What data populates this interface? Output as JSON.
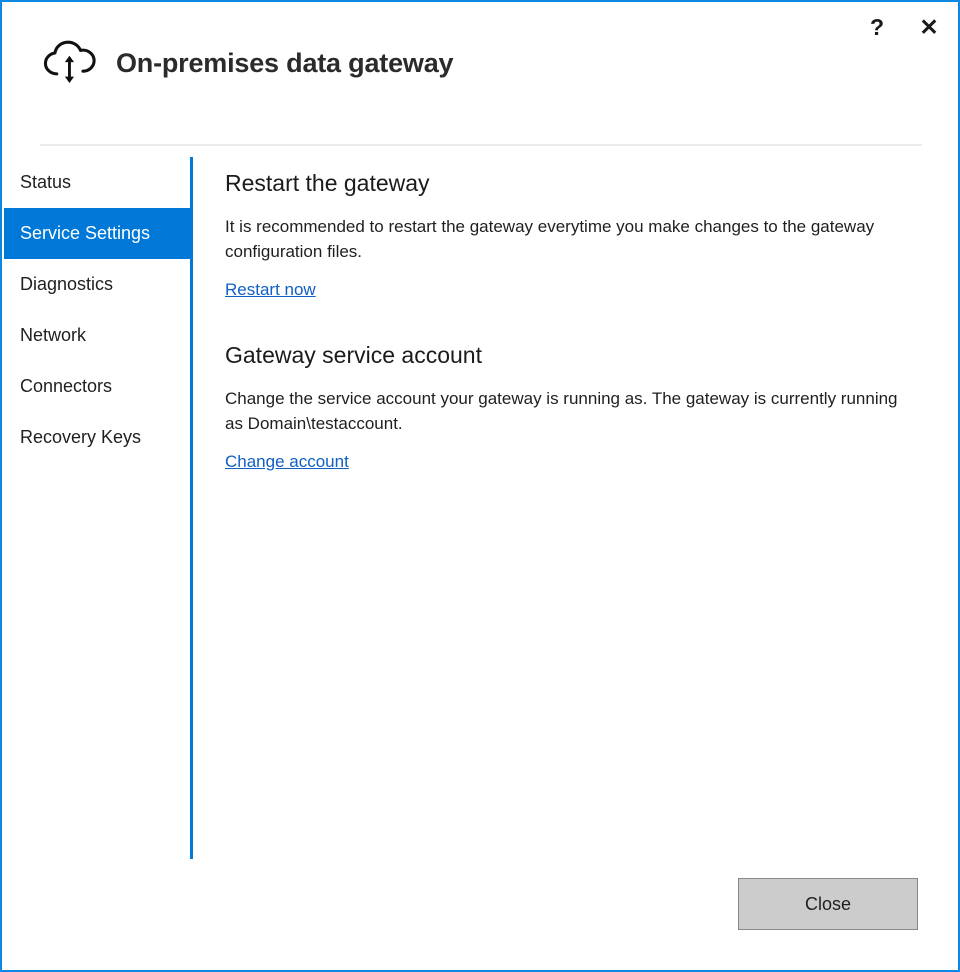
{
  "window": {
    "border_color": "#0d87e0",
    "accent_color": "#0078d7",
    "link_color": "#1060c4"
  },
  "titlebar": {
    "help_label": "?",
    "close_label": "✕",
    "help_icon": "question-mark-icon",
    "close_icon": "close-x-icon"
  },
  "header": {
    "title": "On-premises data gateway",
    "icon": "cloud-with-up-down-arrow-icon"
  },
  "sidebar": {
    "items": [
      {
        "label": "Status",
        "selected": false
      },
      {
        "label": "Service Settings",
        "selected": true
      },
      {
        "label": "Diagnostics",
        "selected": false
      },
      {
        "label": "Network",
        "selected": false
      },
      {
        "label": "Connectors",
        "selected": false
      },
      {
        "label": "Recovery Keys",
        "selected": false
      }
    ]
  },
  "main": {
    "sections": [
      {
        "title": "Restart the gateway",
        "body": "It is recommended to restart the gateway everytime you make changes to the gateway configuration files.",
        "link": "Restart now"
      },
      {
        "title": "Gateway service account",
        "body": "Change the service account your gateway is running as. The gateway is currently running as Domain\\testaccount.",
        "link": "Change account"
      }
    ]
  },
  "footer": {
    "close_label": "Close"
  }
}
